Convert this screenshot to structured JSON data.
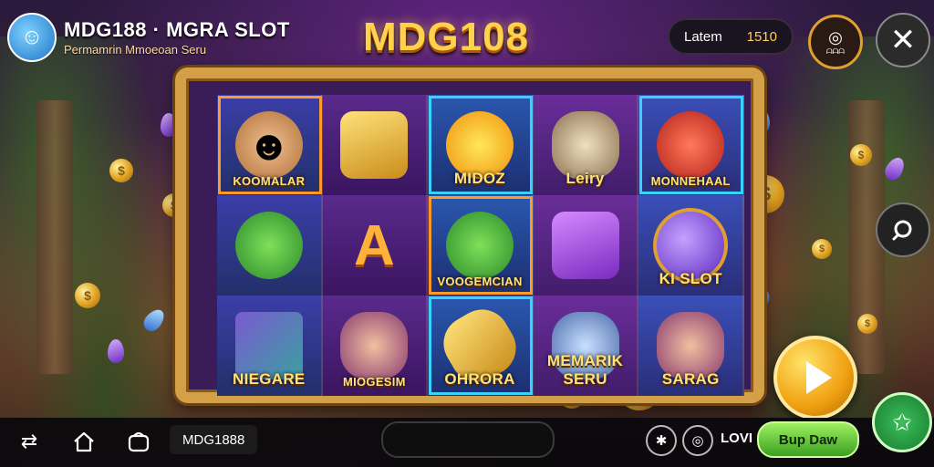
{
  "header": {
    "brand": "MDG188 · MGRA SLOT",
    "subtitle": "Permamrin Mmoeoan Seru",
    "game_title": "MDG108"
  },
  "balance": {
    "label": "Latem",
    "value": "1510"
  },
  "camera_button": {
    "label": "ᗩᗩᗩ"
  },
  "reels": [
    [
      {
        "label": "KOOMALAR",
        "symbol": "hero"
      },
      {
        "label": "",
        "symbol": "corn"
      },
      {
        "label": "NIEGARE",
        "symbol": "cube"
      }
    ],
    [
      {
        "label": "",
        "symbol": "gold-cup"
      },
      {
        "label": "",
        "symbol": "A"
      },
      {
        "label": "MIOGESIM",
        "symbol": "queen"
      }
    ],
    [
      {
        "label": "MIDOZ",
        "symbol": "sun"
      },
      {
        "label": "VOOGEMCIAN",
        "symbol": "frog"
      },
      {
        "label": "OHRORA",
        "symbol": "gold-bar"
      }
    ],
    [
      {
        "label": "Leiry",
        "symbol": "dog"
      },
      {
        "label": "",
        "symbol": "purple-key"
      },
      {
        "label": "MEMARIK SERU",
        "symbol": "wolf"
      }
    ],
    [
      {
        "label": "MONNEHAAL",
        "symbol": "dragon"
      },
      {
        "label": "KI SLOT",
        "symbol": "orb"
      },
      {
        "label": "SARAG",
        "symbol": "girl"
      }
    ]
  ],
  "bottom_bar": {
    "game_name": "MDG1888",
    "lovi_label": "LOVI",
    "buy_label": "Bup Daw"
  },
  "colors": {
    "frame": "#d3a047",
    "title": "#ffd24a",
    "buy": "#7ad44a"
  }
}
